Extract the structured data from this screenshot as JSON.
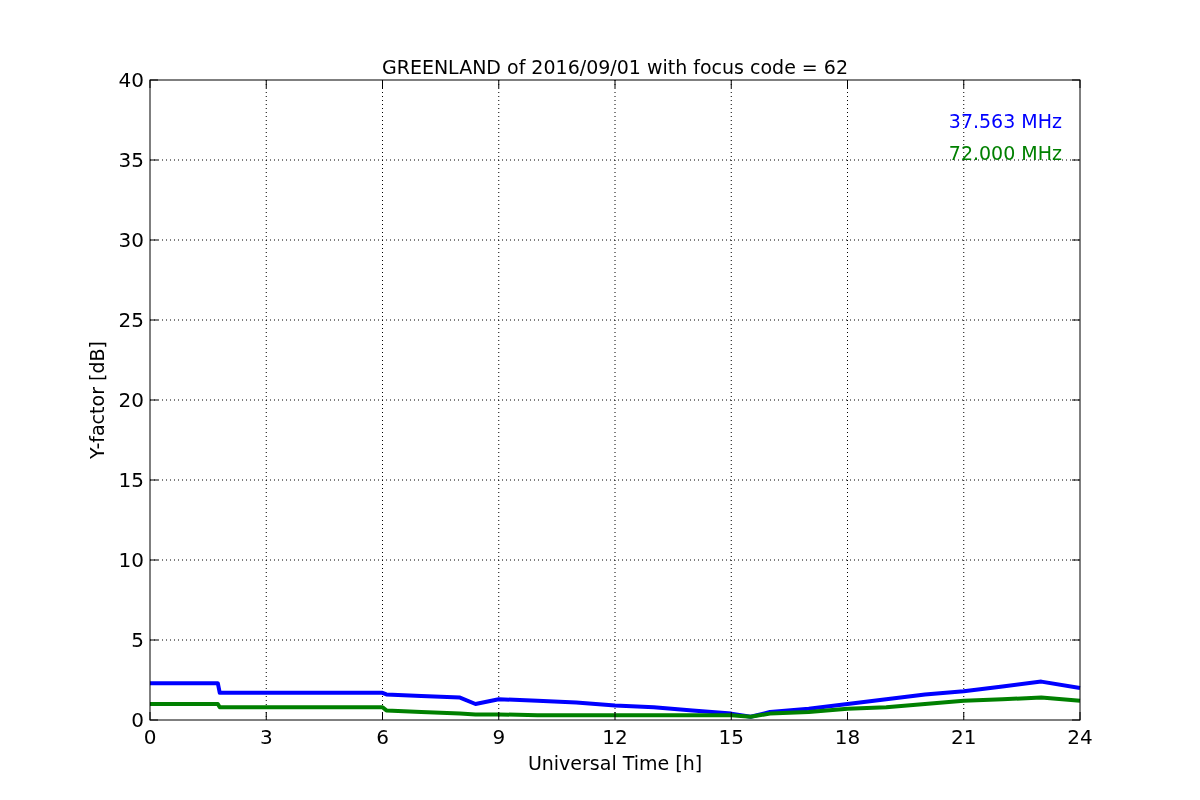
{
  "chart_data": {
    "type": "line",
    "title": "GREENLAND of 2016/09/01 with focus code = 62",
    "xlabel": "Universal Time [h]",
    "ylabel": "Y-factor [dB]",
    "x": [
      0,
      1,
      1.75,
      1.8,
      3,
      6,
      6.1,
      7,
      8,
      8.4,
      9,
      10,
      11,
      12,
      13,
      14,
      15,
      15.5,
      16,
      17,
      18,
      19,
      20,
      21,
      22,
      23,
      24
    ],
    "series": [
      {
        "name": "37.563 MHz",
        "color": "#0000ff",
        "values": [
          2.3,
          2.3,
          2.3,
          1.7,
          1.7,
          1.7,
          1.6,
          1.5,
          1.4,
          1.0,
          1.3,
          1.2,
          1.1,
          0.9,
          0.8,
          0.6,
          0.4,
          0.2,
          0.5,
          0.7,
          1.0,
          1.3,
          1.6,
          1.8,
          2.1,
          2.4,
          2.0
        ]
      },
      {
        "name": "72.000 MHz",
        "color": "#008000",
        "values": [
          1.0,
          1.0,
          1.0,
          0.8,
          0.8,
          0.8,
          0.6,
          0.5,
          0.4,
          0.35,
          0.35,
          0.3,
          0.3,
          0.3,
          0.3,
          0.3,
          0.3,
          0.2,
          0.4,
          0.5,
          0.7,
          0.8,
          1.0,
          1.2,
          1.3,
          1.4,
          1.2
        ]
      }
    ],
    "grid": true,
    "xlim": [
      0,
      24
    ],
    "ylim": [
      0,
      40
    ],
    "xticks": [
      0,
      3,
      6,
      9,
      12,
      15,
      18,
      21,
      24
    ],
    "yticks": [
      0,
      5,
      10,
      15,
      20,
      25,
      30,
      35,
      40
    ]
  }
}
